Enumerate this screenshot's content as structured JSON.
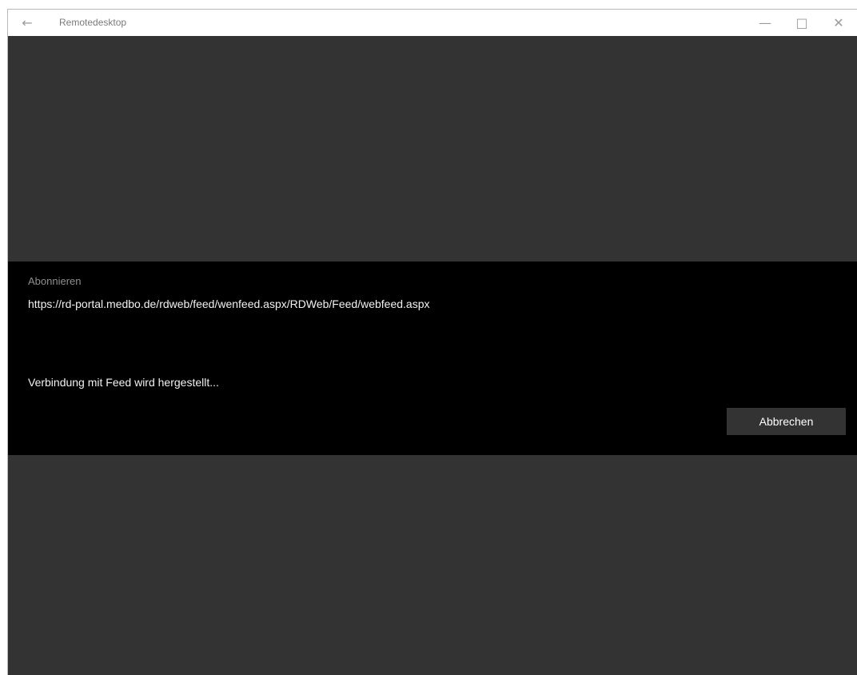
{
  "window": {
    "title": "Remotedesktop",
    "back_icon": "←",
    "minimize_icon": "—",
    "maximize_icon": "□",
    "close_icon": "✕"
  },
  "dialog": {
    "header": "Abonnieren",
    "url": "https://rd-portal.medbo.de/rdweb/feed/wenfeed.aspx/RDWeb/Feed/webfeed.aspx",
    "status": "Verbindung mit Feed wird hergestellt...",
    "cancel_label": "Abbrechen"
  }
}
